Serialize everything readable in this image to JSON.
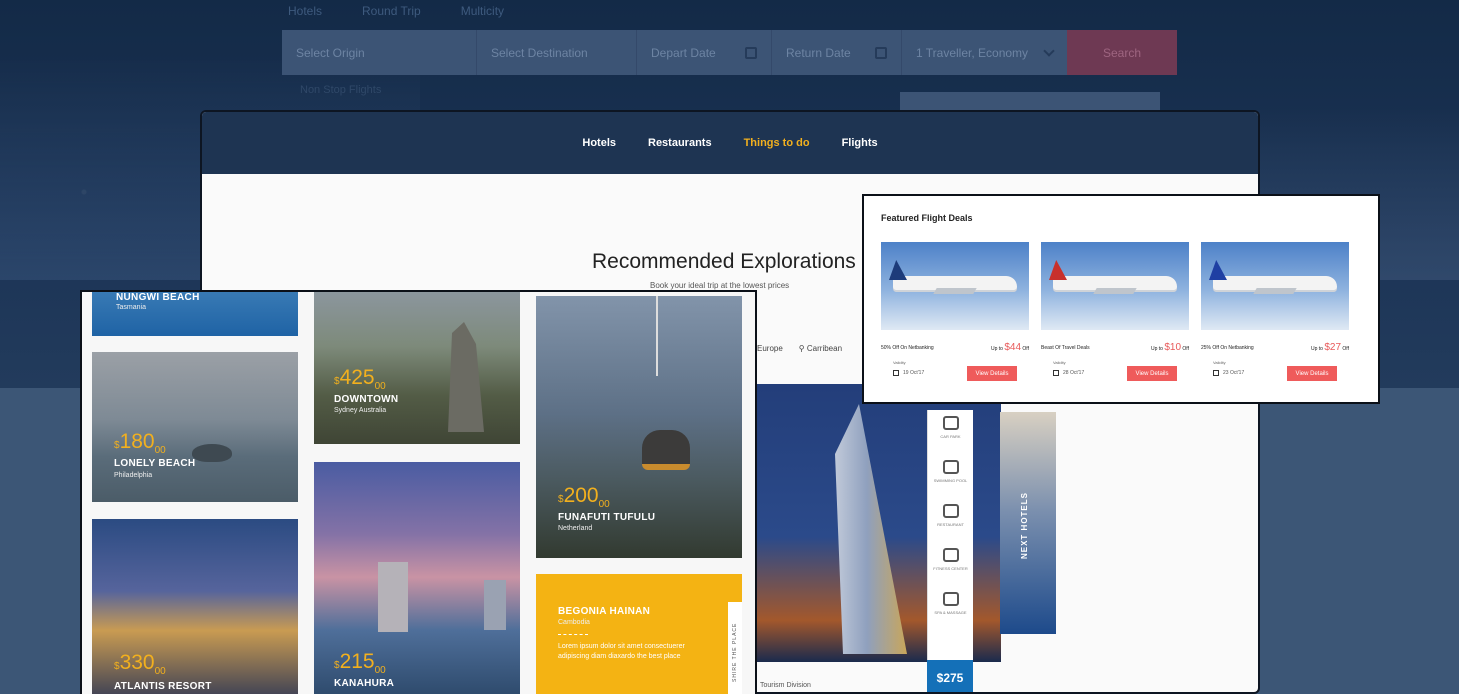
{
  "faded_nav": [
    "Hotels",
    "Round Trip",
    "Multicity"
  ],
  "search": {
    "origin": "Select Origin",
    "destination": "Select Destination",
    "depart": "Depart Date",
    "return": "Return Date",
    "traveller": "1 Traveller, Economy",
    "button": "Search",
    "sub": "Non Stop Flights"
  },
  "nav": {
    "items": [
      "Hotels",
      "Restaurants",
      "Things to do",
      "Flights"
    ],
    "active": "Things to do"
  },
  "recommended": {
    "title": "Recommended Explorations",
    "subtitle": "Book your ideal trip at the lowest prices",
    "filters": [
      "Europe",
      "Carribean"
    ]
  },
  "tiles": {
    "nungwi": {
      "title": "NUNGWI BEACH",
      "loc": "Tasmania"
    },
    "lonely": {
      "currency": "$",
      "price": "180",
      "cents": "00",
      "title": "LONELY BEACH",
      "loc": "Philadelphia"
    },
    "atlantis": {
      "currency": "$",
      "price": "330",
      "cents": "00",
      "title": "ATLANTIS RESORT"
    },
    "downtown": {
      "currency": "$",
      "price": "425",
      "cents": "00",
      "title": "DOWNTOWN",
      "loc": "Sydney Australia"
    },
    "kanahura": {
      "currency": "$",
      "price": "215",
      "cents": "00",
      "title": "KANAHURA"
    },
    "funafuti": {
      "currency": "$",
      "price": "200",
      "cents": "00",
      "title": "FUNAFUTI TUFULU",
      "loc": "Netherland"
    },
    "begonia": {
      "title": "BEGONIA HAINAN",
      "loc": "Cambodia",
      "desc": "Lorem ipsum dolor sit amet consectuerer adipiscing diam diaxardo the best place",
      "side": "SHIRE THE PLACE"
    }
  },
  "amenities": [
    "CAR PARK",
    "SWIMMING POOL",
    "RESTAURANT",
    "FITNESS CENTER",
    "SPA & MASSAGE"
  ],
  "hotel": {
    "price": "$275",
    "side_label": "NEXT HOTELS",
    "tourism": "Tourism Division"
  },
  "featured": {
    "title": "Featured Flight Deals",
    "deals": [
      {
        "offer": "50% Off On Netbanking",
        "upto": "Up to",
        "amount": "$44",
        "off": "Off",
        "validity": "Validity",
        "date": "19 Oct'17",
        "button": "View Details",
        "tail_color": "#1d3b7a"
      },
      {
        "offer": "Beast Of Travel Deals",
        "upto": "Up to",
        "amount": "$10",
        "off": "Off",
        "validity": "Validity",
        "date": "28 Oct'17",
        "button": "View Details",
        "tail_color": "#c8302c"
      },
      {
        "offer": "25% Off On Netbanking",
        "upto": "Up to",
        "amount": "$27",
        "off": "Off",
        "validity": "Validity",
        "date": "23 Oct'17",
        "button": "View Details",
        "tail_color": "#1f3fa3"
      }
    ]
  },
  "colors": {
    "accent": "#f2b01e",
    "navy": "#1e3452",
    "red": "#ef5b5b",
    "blue": "#1470b8"
  }
}
